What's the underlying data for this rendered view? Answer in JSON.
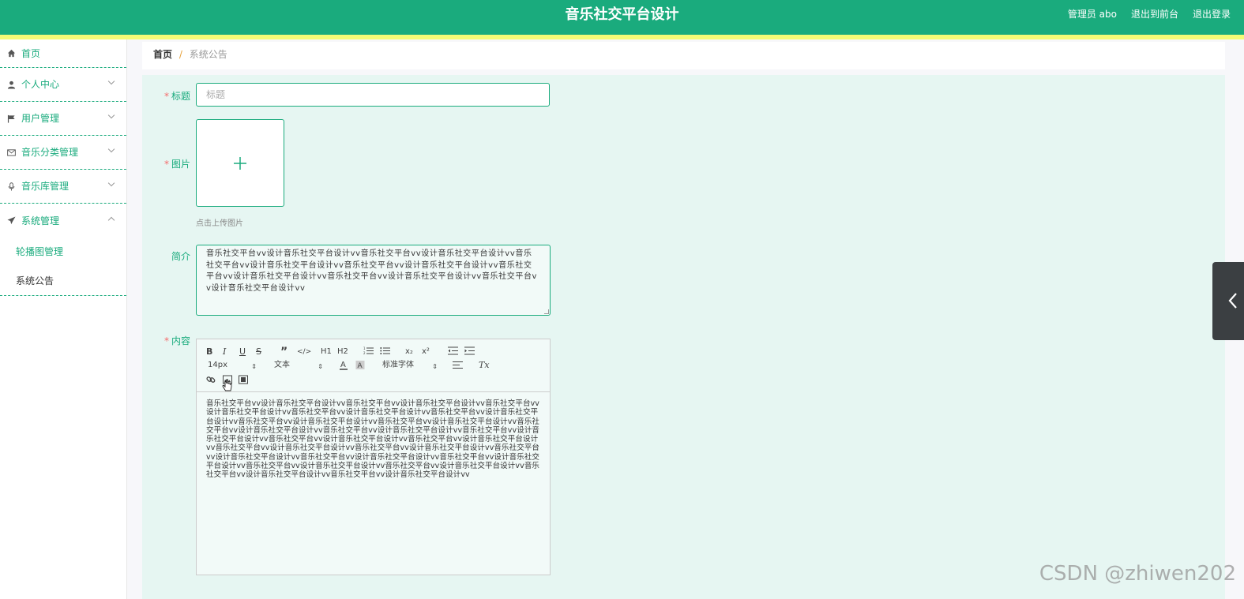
{
  "header": {
    "title": "音乐社交平台设计",
    "admin_label": "管理员 abo",
    "back_label": "退出到前台",
    "logout_label": "退出登录"
  },
  "sidebar": {
    "items": [
      {
        "label": "首页",
        "icon": "home-icon"
      },
      {
        "label": "个人中心",
        "icon": "user-icon"
      },
      {
        "label": "用户管理",
        "icon": "flag-icon"
      },
      {
        "label": "音乐分类管理",
        "icon": "mail-icon"
      },
      {
        "label": "音乐库管理",
        "icon": "mic-icon"
      },
      {
        "label": "系统管理",
        "icon": "send-icon"
      }
    ],
    "subitems": [
      {
        "label": "轮播图管理"
      },
      {
        "label": "系统公告"
      }
    ]
  },
  "breadcrumb": {
    "home": "首页",
    "separator": "/",
    "current": "系统公告"
  },
  "form": {
    "title_label": "标题",
    "title_placeholder": "标题",
    "image_label": "图片",
    "upload_hint": "点击上传图片",
    "intro_label": "简介",
    "intro_text": "音乐社交平台vv设计音乐社交平台设计vv音乐社交平台vv设计音乐社交平台设计vv音乐社交平台vv设计音乐社交平台设计vv音乐社交平台vv设计音乐社交平台设计vv音乐社交平台vv设计音乐社交平台设计vv音乐社交平台vv设计音乐社交平台设计vv音乐社交平台vv设计音乐社交平台设计vv",
    "content_label": "内容",
    "content_text": "音乐社交平台vv设计音乐社交平台设计vv音乐社交平台vv设计音乐社交平台设计vv音乐社交平台vv设计音乐社交平台设计vv音乐社交平台vv设计音乐社交平台设计vv音乐社交平台vv设计音乐社交平台设计vv音乐社交平台vv设计音乐社交平台设计vv音乐社交平台vv设计音乐社交平台设计vv音乐社交平台vv设计音乐社交平台设计vv音乐社交平台vv设计音乐社交平台设计vv音乐社交平台vv设计音乐社交平台设计vv音乐社交平台vv设计音乐社交平台设计vv音乐社交平台vv设计音乐社交平台设计vv音乐社交平台vv设计音乐社交平台设计vv音乐社交平台vv设计音乐社交平台设计vv音乐社交平台vv设计音乐社交平台设计vv音乐社交平台vv设计音乐社交平台设计vv音乐社交平台vv设计音乐社交平台设计vv音乐社交平台vv设计音乐社交平台设计vv音乐社交平台vv设计音乐社交平台设计vv音乐社交平台vv设计音乐社交平台设计vv音乐社交平台vv设计音乐社交平台设计vv"
  },
  "toolbar": {
    "bold": "B",
    "italic": "I",
    "underline": "U",
    "strike": "S",
    "quote": "”",
    "code": "</>",
    "h1": "H1",
    "h2": "H2",
    "subscript": "x₂",
    "superscript": "x²",
    "font_size": "14px",
    "text_type": "文本",
    "font_family": "标准字体",
    "clear": "Tx"
  },
  "watermark": "CSDN @zhiwen202",
  "colors": {
    "primary": "#1aab7d",
    "accent_strip": "#f4fb76",
    "form_bg": "#e6f6f2",
    "required": "#f56c6c"
  }
}
